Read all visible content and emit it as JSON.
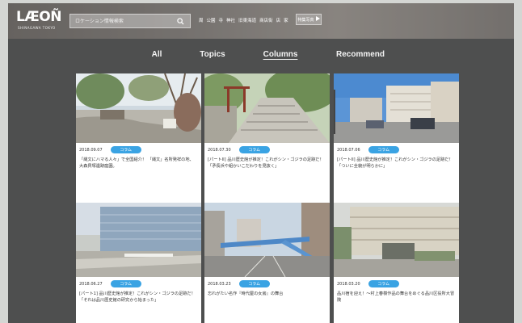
{
  "header": {
    "logo": "LÆOÑ",
    "logo_sub": "SHINAGAWA TOKYO",
    "search_placeholder": "ロケーション情報検索",
    "nav_items": [
      "周",
      "公園",
      "寺",
      "神社",
      "旧東海道",
      "商店街",
      "店",
      "家"
    ],
    "feature_button": "特集写真"
  },
  "tabs": [
    "All",
    "Topics",
    "Columns",
    "Recommend"
  ],
  "active_tab": "Columns",
  "cards": [
    {
      "date": "2018.09.07",
      "category": "コラム",
      "title": "「縄文にハマる人々」で全国紹介！ 「縄文」名所発祥の地、大森貝塚遺跡庭園。"
    },
    {
      "date": "2018.07.30",
      "category": "コラム",
      "title": "[パートII] 品川歴史館が推定！これがシン・ゴジラの足跡だ！「矛長浜や組かいこだわりを見抜く」"
    },
    {
      "date": "2018.07.06",
      "category": "コラム",
      "title": "[パートII] 品川歴史館が推定！これがシン・ゴジラの足跡だ！「ついに全貌が明らかに」"
    },
    {
      "date": "2018.06.27",
      "category": "コラム",
      "title": "[パート1] 品川歴史館が推定！これがシン・ゴジラの足跡だ！「それは品川歴史館の研究から始まった」"
    },
    {
      "date": "2018.03.23",
      "category": "コラム",
      "title": "忘れがたい名作『時代屋の女房』の舞台"
    },
    {
      "date": "2018.03.20",
      "category": "コラム",
      "title": "品川宿を迎え！～村上春樹作品の舞台をめぐる品川区役所大冒険"
    }
  ],
  "colors": {
    "badge": "#3aa3e3",
    "page_background": "#4e4f4f",
    "card_background": "#ffffff"
  }
}
